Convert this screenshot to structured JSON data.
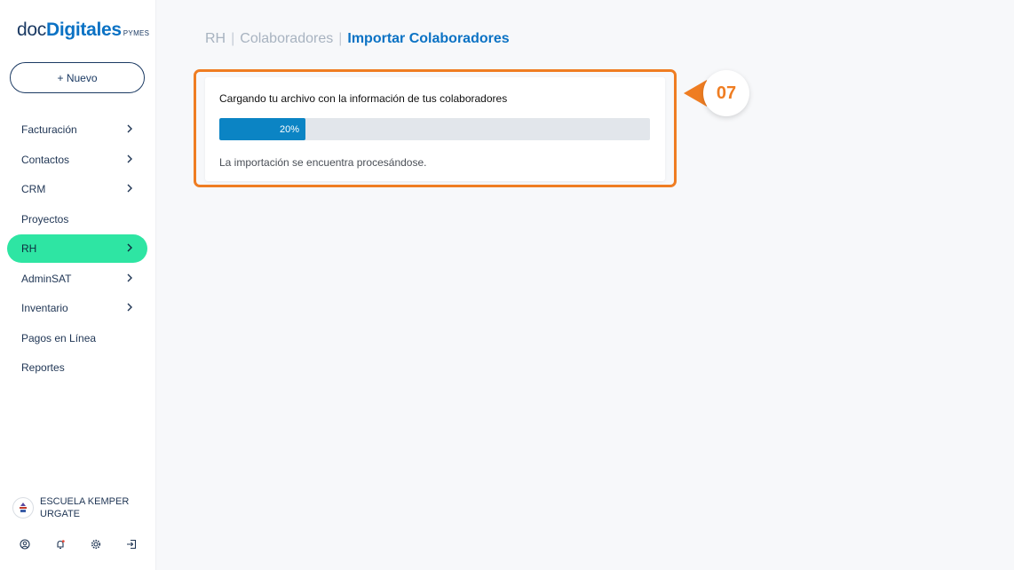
{
  "logo": {
    "part1": "doc",
    "part2": "Digitales",
    "suffix": "PYMES"
  },
  "new_button": {
    "label": "+ Nuevo"
  },
  "sidebar": {
    "items": [
      {
        "label": "Facturación",
        "chevron": true
      },
      {
        "label": "Contactos",
        "chevron": true
      },
      {
        "label": "CRM",
        "chevron": true
      },
      {
        "label": "Proyectos",
        "chevron": false
      },
      {
        "label": "RH",
        "chevron": true,
        "active": true
      },
      {
        "label": "AdminSAT",
        "chevron": true
      },
      {
        "label": "Inventario",
        "chevron": true
      },
      {
        "label": "Pagos en Línea",
        "chevron": false
      },
      {
        "label": "Reportes",
        "chevron": false
      }
    ],
    "active_color": "#2ee5a3"
  },
  "org": {
    "name_line1": "ESCUELA KEMPER",
    "name_line2": "URGATE"
  },
  "bottom_icons": [
    "user-icon",
    "bell-icon",
    "gear-icon",
    "logout-icon"
  ],
  "breadcrumb": {
    "level1": "RH",
    "separator": "|",
    "level2": "Colaboradores",
    "current": "Importar Colaboradores"
  },
  "import_card": {
    "title": "Cargando tu archivo con la información de tus colaboradores",
    "progress_label": "20%",
    "progress_value": 0.2,
    "status": "La importación se encuentra procesándose."
  },
  "step_badge": {
    "label": "07",
    "color": "#ef7d22"
  }
}
